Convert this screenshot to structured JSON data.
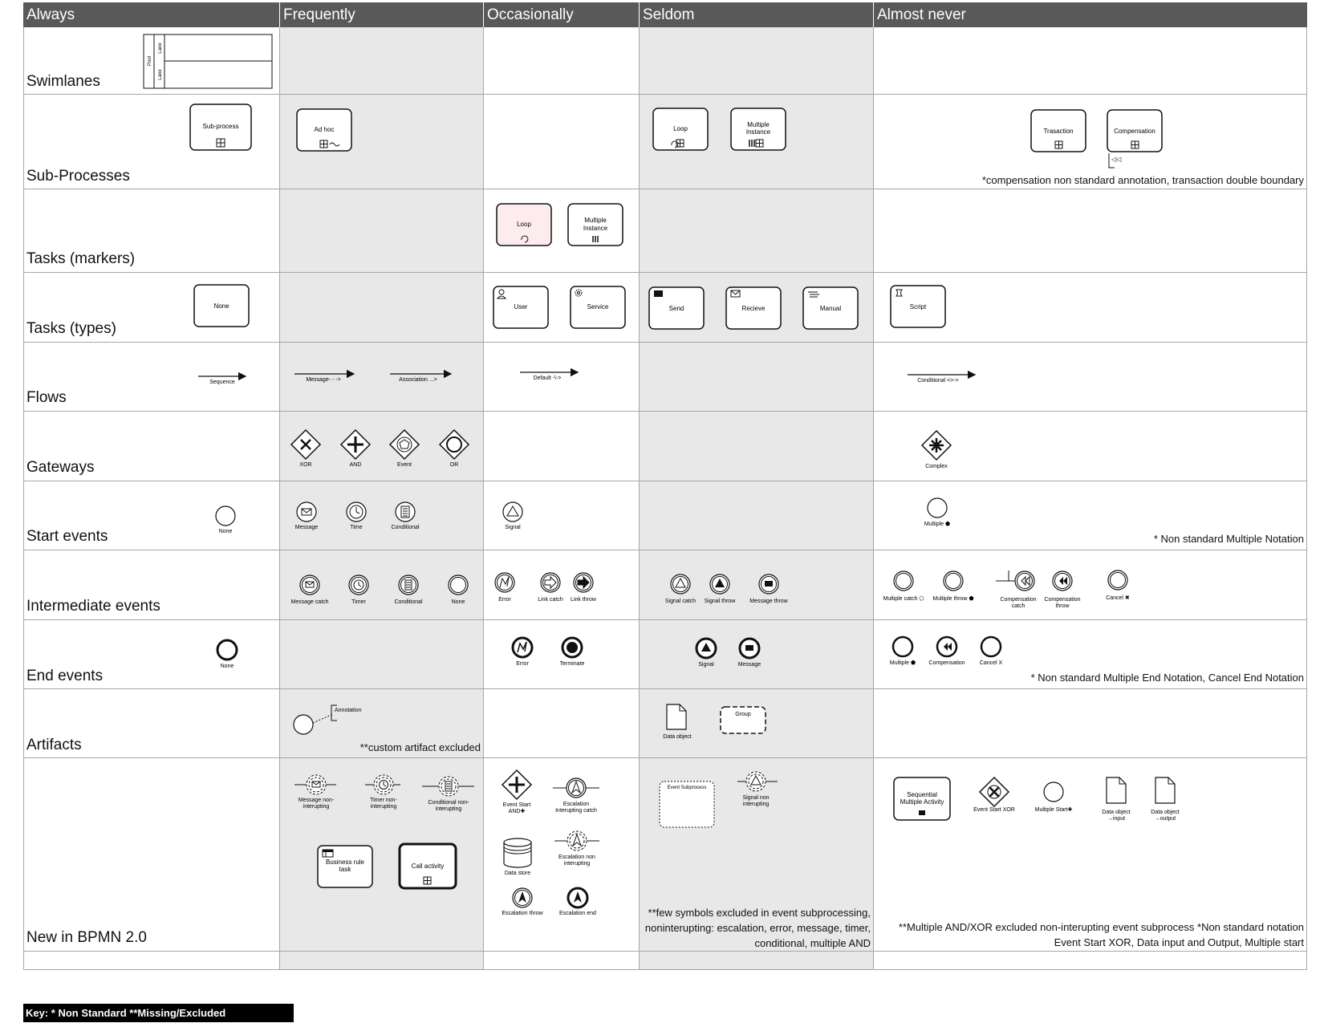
{
  "columns": [
    "Always",
    "Frequently",
    "Occasionally",
    "Seldom",
    "Almost never"
  ],
  "rows": [
    "Swimlanes",
    "Sub-Processes",
    "Tasks (markers)",
    "Tasks (types)",
    "Flows",
    "Gateways",
    "Start events",
    "Intermediate events",
    "End events",
    "Artifacts",
    "New in BPMN 2.0"
  ],
  "notes": {
    "subprocesses": "*compensation non standard annotation, transaction double boundary",
    "start_events": "* Non standard Multiple Notation",
    "end_events": "* Non standard Multiple End Notation, Cancel End Notation",
    "artifacts": "**custom artifact excluded",
    "new_seldom": "**few symbols excluded in event subprocessing, noninterupting: escalation, error, message, timer, conditional, multiple AND",
    "new_almost_never": "**Multiple AND/XOR excluded non-interupting event subprocess *Non standard notation Event Start XOR, Data input and Output, Multiple start"
  },
  "key": "Key: * Non Standard **Missing/Excluded",
  "labels": {
    "pool": "Pool",
    "lane1": "Lane",
    "lane2": "Lane",
    "sub_process": "Sub-process",
    "ad_hoc": "Ad hoc",
    "loop": "Loop",
    "multiple_instance_l1": "Multiple",
    "multiple_instance_l2": "Instance",
    "transaction": "Trasaction",
    "compensation": "Compensation",
    "task_loop": "Loop",
    "task_mi_l1": "Multiple",
    "task_mi_l2": "Instance",
    "none_task": "None",
    "user": "User",
    "service": "Service",
    "send": "Send",
    "receive": "Recieve",
    "manual": "Manual",
    "script": "Script",
    "sequence": "Sequence",
    "message_flow": "Message- - ->",
    "association": "Association ...>",
    "default_flow": "Default -\\->",
    "conditional_flow": "Conditional <>->",
    "xor": "XOR",
    "and": "AND",
    "event_gw": "Event",
    "or": "OR",
    "complex": "Complex",
    "start_none": "None",
    "start_message": "Message",
    "start_time": "Time",
    "start_conditional": "Conditional",
    "start_signal": "Signal",
    "start_multiple": "Multiple ⬟",
    "int_message_catch": "Message catch",
    "int_timer": "Timer",
    "int_conditional": "Conditional",
    "int_none": "None",
    "int_error": "Error",
    "int_link_catch": "Link catch",
    "int_link_throw": "Link throw",
    "int_signal_catch": "Signal catch",
    "int_signal_throw": "Signal throw",
    "int_message_throw": "Message throw",
    "int_multiple_catch": "Multiple catch ⬠",
    "int_multiple_throw": "Multiple throw ⬟",
    "int_comp_catch_l1": "Compensation",
    "int_comp_catch_l2": "catch",
    "int_comp_throw_l1": "Compensation",
    "int_comp_throw_l2": "throw",
    "int_cancel": "Cancel ✖",
    "end_none": "None",
    "end_error": "Error",
    "end_terminate": "Terminate",
    "end_signal": "Signal",
    "end_message": "Message",
    "end_multiple": "Multiple ⬟",
    "end_compensation": "Compensation",
    "end_cancel": "Cancel X",
    "annotation": "Annotation",
    "data_object": "Data object",
    "group": "Group",
    "msg_nonint_l1": "Message non-",
    "msg_nonint_l2": "interupting",
    "timer_nonint_l1": "Timer non-",
    "timer_nonint_l2": "interupting",
    "cond_nonint_l1": "Conditional non-",
    "cond_nonint_l2": "interupting",
    "business_rule_l1": "Business rule",
    "business_rule_l2": "task",
    "call_activity": "Call activity",
    "event_start_and_l1": "Event Start",
    "event_start_and_l2": "AND✚",
    "esc_int_catch_l1": "Escalation",
    "esc_int_catch_l2": "Interupting catch",
    "data_store": "Data store",
    "esc_nonint_l1": "Escalation non",
    "esc_nonint_l2": "interupting",
    "esc_throw": "Escalation throw",
    "esc_end": "Escalation end",
    "event_subprocess": "Event Subprocess",
    "signal_nonint_l1": "Signal non",
    "signal_nonint_l2": "interupting",
    "seq_mi_l1": "Sequential",
    "seq_mi_l2": "Multiple Activity",
    "event_start_xor": "Event Start XOR",
    "multiple_start": "Multiple Start✚",
    "data_input_l1": "Data object",
    "data_input_l2": "→input",
    "data_output_l1": "Data object",
    "data_output_l2": "→output"
  }
}
